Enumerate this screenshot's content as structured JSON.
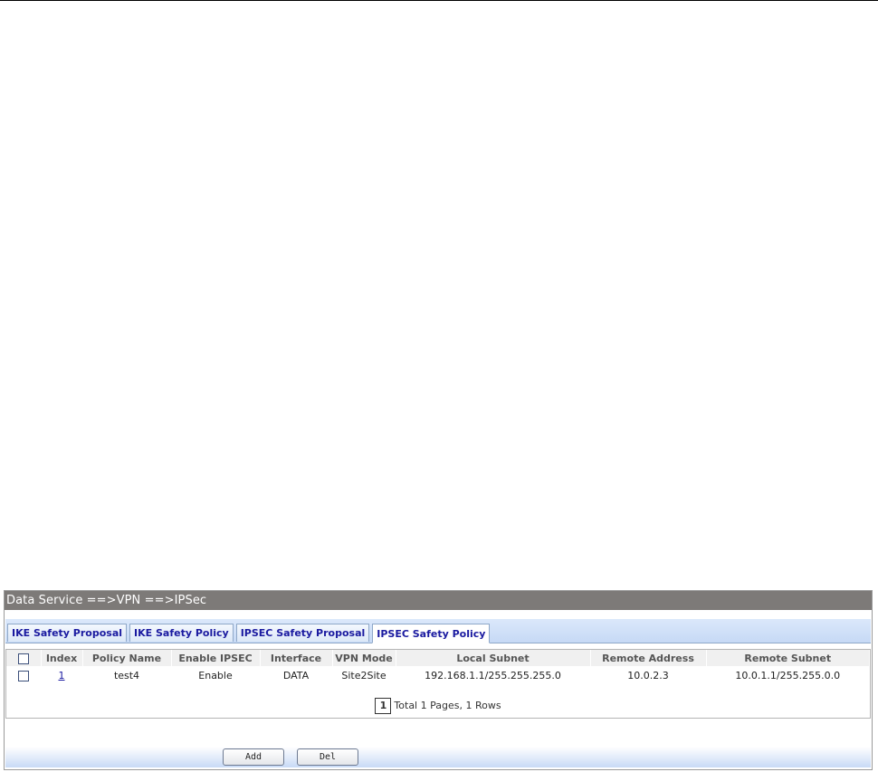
{
  "breadcrumb": "Data Service ==>VPN ==>IPSec",
  "tabs": [
    {
      "label": "IKE Safety Proposal",
      "active": false
    },
    {
      "label": "IKE Safety Policy",
      "active": false
    },
    {
      "label": "IPSEC Safety Proposal",
      "active": false
    },
    {
      "label": "IPSEC Safety Policy",
      "active": true
    }
  ],
  "table": {
    "columns": [
      "Index",
      "Policy Name",
      "Enable IPSEC",
      "Interface",
      "VPN Mode",
      "Local Subnet",
      "Remote Address",
      "Remote Subnet"
    ],
    "rows": [
      {
        "index": "1",
        "policy_name": "test4",
        "enable_ipsec": "Enable",
        "interface": "DATA",
        "vpn_mode": "Site2Site",
        "local_subnet": "192.168.1.1/255.255.255.0",
        "remote_address": "10.0.2.3",
        "remote_subnet": "10.0.1.1/255.255.0.0"
      }
    ]
  },
  "pager": {
    "current_page": "1",
    "summary": "Total 1 Pages, 1 Rows"
  },
  "buttons": {
    "add_label": "Add",
    "del_label": "Del"
  },
  "colors": {
    "title_bar": "#7d7a78",
    "tab_strip": "#c6d9f5",
    "tab_text": "#1a1aa0",
    "button_bar": "#c8daf6"
  }
}
